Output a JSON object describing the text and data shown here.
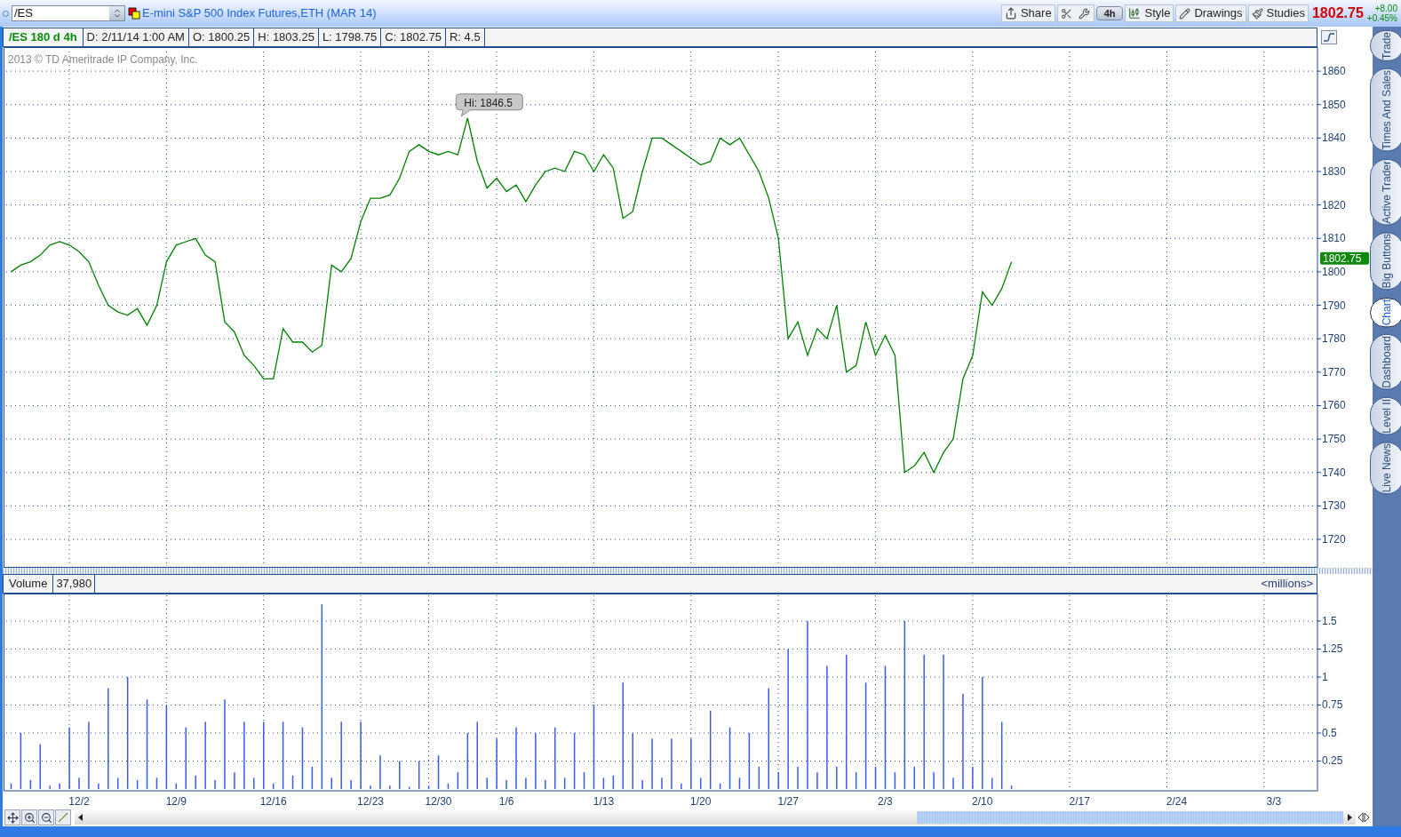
{
  "title_bar": {
    "symbol": "/ES",
    "title": "E-mini S&P 500 Index Futures,ETH (MAR 14)",
    "buttons": [
      {
        "kind": "share",
        "label": "Share"
      },
      {
        "kind": "tools"
      },
      {
        "kind": "aggregation",
        "label": "4h"
      },
      {
        "kind": "style",
        "label": "Style"
      },
      {
        "kind": "drawings",
        "label": "Drawings"
      },
      {
        "kind": "studies",
        "label": "Studies"
      }
    ],
    "quote": {
      "last": "1802.75",
      "change": "+8.00",
      "percent": "+0.45%"
    }
  },
  "info_bar": {
    "study": "/ES 180 d 4h",
    "fields": [
      "D: 2/11/14 1:00 AM",
      "O: 1800.25",
      "H: 1803.25",
      "L: 1798.75",
      "C: 1802.75",
      "R: 4.5"
    ]
  },
  "price_chart": {
    "copyright": "2013 © TD Ameritrade IP Company, Inc.",
    "last_label": "1802.75",
    "chart_data": {
      "type": "line",
      "grid": true,
      "categories": [
        null,
        null,
        null,
        null,
        null,
        null,
        null,
        null,
        null,
        null,
        null,
        null,
        null,
        null,
        null,
        null,
        null,
        null,
        null,
        null,
        null,
        null,
        null,
        null,
        null,
        null,
        null,
        null,
        null,
        null,
        null,
        null,
        null,
        null,
        null,
        null,
        null,
        null,
        null,
        null,
        null,
        null,
        null,
        null,
        null,
        null,
        null,
        null,
        null,
        null,
        null,
        null,
        null,
        null,
        null,
        null,
        null,
        null,
        null,
        null,
        null,
        null,
        null,
        null,
        null,
        null,
        null,
        null,
        null,
        null,
        null,
        null,
        null,
        null,
        null,
        null,
        null,
        null,
        null,
        null,
        null,
        null,
        null,
        null,
        null,
        null,
        null,
        null,
        null,
        null,
        null,
        null,
        null,
        null,
        null,
        null,
        null,
        null,
        null,
        null,
        null,
        null,
        null,
        null,
        null,
        null,
        null,
        null,
        null,
        null,
        null,
        null,
        null,
        null,
        null,
        null,
        null,
        null,
        null,
        null,
        null,
        null,
        null,
        null,
        null,
        null,
        null,
        null,
        null,
        null,
        null,
        null,
        null,
        null,
        null
      ],
      "series": [
        {
          "color": "#008000",
          "values": [
            1800,
            1802,
            1803,
            1805,
            1808,
            1809,
            1808,
            1806,
            1803,
            1796,
            1790,
            1788,
            1787,
            1789,
            1784,
            1790,
            1803,
            1808,
            1809,
            1810,
            1805,
            1803,
            1785,
            1782,
            1775,
            1772,
            1768,
            1768,
            1783,
            1779,
            1779,
            1776,
            1778,
            1802,
            1800,
            1804,
            1815,
            1822,
            1822,
            1823,
            1828,
            1836,
            1838,
            1836,
            1835,
            1836,
            1835,
            1846,
            1833,
            1825,
            1828,
            1824,
            1826,
            1821,
            1826,
            1830,
            1831,
            1830,
            1836,
            1835,
            1830,
            1835,
            1831,
            1816,
            1818,
            1830,
            1840,
            1840,
            1838,
            1836,
            1834,
            1832,
            1833,
            1840,
            1838,
            1840,
            1835,
            1830,
            1822,
            1810,
            1780,
            1785,
            1775,
            1783,
            1780,
            1790,
            1770,
            1772,
            1785,
            1775,
            1781,
            1775,
            1740,
            1742,
            1746,
            1740,
            1746,
            1750,
            1768,
            1775,
            1794,
            1790,
            1795,
            1803,
            null,
            null,
            null,
            null,
            null,
            null,
            null,
            null,
            null,
            null,
            null,
            null,
            null,
            null,
            null,
            null,
            null,
            null,
            null,
            null,
            null,
            null,
            null,
            null,
            null,
            null,
            null,
            null,
            null,
            null,
            null
          ]
        }
      ],
      "ylim": [
        1711.5,
        1867.2
      ],
      "yticks": [
        1720,
        1730,
        1740,
        1750,
        1760,
        1770,
        1780,
        1790,
        1800,
        1810,
        1820,
        1830,
        1840,
        1850,
        1860
      ],
      "annotations": [
        "Hi: 1846.5"
      ]
    }
  },
  "volume_chart": {
    "label": "Volume",
    "value": "37,980",
    "units": "<millions>",
    "chart_data": {
      "type": "bar",
      "grid": true,
      "categories": [
        null,
        null,
        null,
        null,
        null,
        null,
        null,
        "12/2",
        null,
        null,
        null,
        null,
        null,
        null,
        null,
        null,
        null,
        "12/9",
        null,
        null,
        null,
        null,
        null,
        null,
        null,
        null,
        null,
        "12/16",
        null,
        null,
        null,
        null,
        null,
        null,
        null,
        null,
        null,
        "12/23",
        null,
        null,
        null,
        null,
        null,
        null,
        "12/30",
        null,
        null,
        null,
        null,
        null,
        null,
        "1/6",
        null,
        null,
        null,
        null,
        null,
        null,
        null,
        null,
        null,
        "1/13",
        null,
        null,
        null,
        null,
        null,
        null,
        null,
        null,
        null,
        "1/20",
        null,
        null,
        null,
        null,
        null,
        null,
        null,
        null,
        "1/27",
        null,
        null,
        null,
        null,
        null,
        null,
        null,
        null,
        null,
        "2/3",
        null,
        null,
        null,
        null,
        null,
        null,
        null,
        null,
        null,
        "2/10",
        null,
        null,
        null,
        null,
        null,
        null,
        null,
        null,
        null,
        "2/17",
        null,
        null,
        null,
        null,
        null,
        null,
        null,
        null,
        null,
        "2/24",
        null,
        null,
        null,
        null,
        null,
        null,
        null,
        null,
        null,
        "3/3",
        null,
        null,
        null,
        null
      ],
      "series": [
        {
          "color": "#3b5bf0",
          "values": [
            0.05,
            0.5,
            0.08,
            0.4,
            0.03,
            0.05,
            0.55,
            0.1,
            0.6,
            0.05,
            0.9,
            0.1,
            1.0,
            0.08,
            0.8,
            0.1,
            0.75,
            0.05,
            0.55,
            0.12,
            0.6,
            0.08,
            0.8,
            0.15,
            0.6,
            0.1,
            0.6,
            0.05,
            0.6,
            0.12,
            0.55,
            0.2,
            1.65,
            0.1,
            0.6,
            0.08,
            0.6,
            0.03,
            0.3,
            0.03,
            0.25,
            0.02,
            0.25,
            0.03,
            0.3,
            0.05,
            0.15,
            0.5,
            0.6,
            0.1,
            0.45,
            0.08,
            0.55,
            0.1,
            0.5,
            0.08,
            0.55,
            0.1,
            0.5,
            0.15,
            0.75,
            0.1,
            0.12,
            0.95,
            0.5,
            0.08,
            0.45,
            0.1,
            0.45,
            0.05,
            0.45,
            0.1,
            0.7,
            0.05,
            0.55,
            0.1,
            0.5,
            0.2,
            0.9,
            0.15,
            1.25,
            0.2,
            1.5,
            0.15,
            1.1,
            0.2,
            1.2,
            0.15,
            0.95,
            0.2,
            1.1,
            0.15,
            1.5,
            0.2,
            1.2,
            0.15,
            1.2,
            0.1,
            0.85,
            0.2,
            1.0,
            0.1,
            0.6,
            0.03,
            null,
            null,
            null,
            null,
            null,
            null,
            null,
            null,
            null,
            null,
            null,
            null,
            null,
            null,
            null,
            null,
            null,
            null,
            null,
            null,
            null,
            null,
            null,
            null,
            null,
            null,
            null,
            null,
            null,
            null,
            null
          ]
        }
      ],
      "ylim": [
        -0.016,
        1.73
      ],
      "yticks": [
        0.25,
        0.5,
        0.75,
        1,
        1.25,
        1.5
      ]
    }
  },
  "side_tabs": [
    {
      "label": "Trade",
      "selected": false
    },
    {
      "label": "Times And Sales",
      "selected": false
    },
    {
      "label": "Active Trader",
      "selected": false
    },
    {
      "label": "Big Buttons",
      "selected": false
    },
    {
      "label": "Chart",
      "selected": true
    },
    {
      "label": "Dashboard",
      "selected": false
    },
    {
      "label": "Level II",
      "selected": false
    },
    {
      "label": "Live News",
      "selected": false
    }
  ]
}
